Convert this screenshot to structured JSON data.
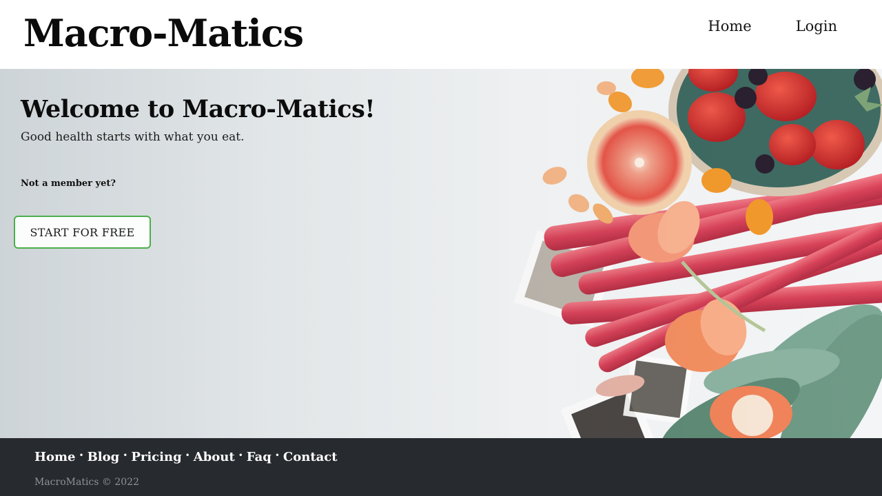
{
  "header": {
    "brand": "Macro-Matics",
    "nav": [
      "Home",
      "Login"
    ]
  },
  "hero": {
    "title": "Welcome to Macro-Matics!",
    "tagline": "Good health starts with what you eat.",
    "member_prompt": "Not a member yet?",
    "cta_label": "START FOR FREE"
  },
  "footer": {
    "links": [
      "Home",
      "Blog",
      "Pricing",
      "About",
      "Faq",
      "Contact"
    ],
    "separator": "•",
    "copyright": "MacroMatics © 2022"
  },
  "colors": {
    "cta_border": "#4cae4c",
    "footer_bg": "#272a2e",
    "rhubarb": "#d9435a",
    "grapefruit": "#e8574a",
    "strawberry": "#d52a2a",
    "leaf": "#6f9a86"
  }
}
